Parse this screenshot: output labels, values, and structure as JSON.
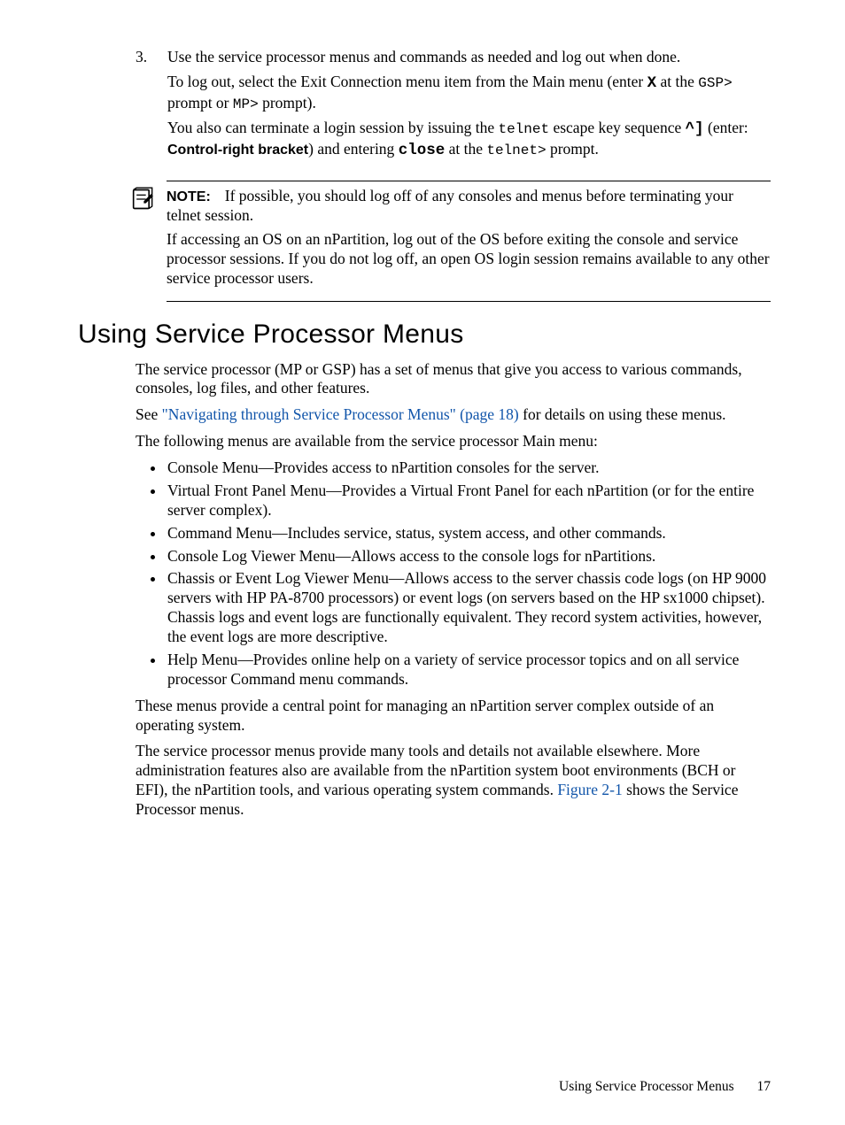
{
  "step": {
    "number": "3.",
    "para1_a": "Use the service processor menus and commands as needed and log out when done.",
    "para2_a": "To log out, select the Exit Connection menu item from the Main menu (enter ",
    "para2_b": "X",
    "para2_c": " at the ",
    "para2_d": "GSP>",
    "para2_e": " prompt or ",
    "para2_f": "MP>",
    "para2_g": " prompt).",
    "para3_a": "You also can terminate a login session by issuing the ",
    "para3_b": "telnet",
    "para3_c": " escape key sequence ",
    "para3_d": "^]",
    "para3_e": " (enter: ",
    "para3_f": "Control-right bracket",
    "para3_g": ") and entering ",
    "para3_h": "close",
    "para3_i": " at the ",
    "para3_j": "telnet>",
    "para3_k": " prompt."
  },
  "note": {
    "label": "NOTE:",
    "p1": "If possible, you should log off of any consoles and menus before terminating your telnet session.",
    "p2": "If accessing an OS on an nPartition, log out of the OS before exiting the console and service processor sessions. If you do not log off, an open OS login session remains available to any other service processor users."
  },
  "section": {
    "heading": "Using Service Processor Menus",
    "p1": "The service processor (MP or GSP) has a set of menus that give you access to various commands, consoles, log files, and other features.",
    "p2_a": "See ",
    "p2_link": "\"Navigating through Service Processor Menus\" (page 18)",
    "p2_b": " for details on using these menus.",
    "p3": "The following menus are available from the service processor Main menu:",
    "bullets": {
      "b1": "Console Menu—Provides access to nPartition consoles for the server.",
      "b2": "Virtual Front Panel Menu—Provides a Virtual Front Panel for each nPartition (or for the entire server complex).",
      "b3": "Command Menu—Includes service, status, system access, and other commands.",
      "b4": "Console Log Viewer Menu—Allows access to the console logs for nPartitions.",
      "b5": "Chassis or Event Log Viewer Menu—Allows access to the server chassis code logs (on HP 9000 servers with HP PA-8700 processors) or event logs (on servers based on the HP sx1000 chipset). Chassis logs and event logs are functionally equivalent. They record system activities, however, the event logs are more descriptive.",
      "b6": "Help Menu—Provides online help on a variety of service processor topics and on all service processor Command menu commands."
    },
    "p4": "These menus provide a central point for managing an nPartition server complex outside of an operating system.",
    "p5_a": "The service processor menus provide many tools and details not available elsewhere. More administration features also are available from the nPartition system boot environments (BCH or EFI), the nPartition tools, and various operating system commands. ",
    "p5_link": "Figure 2-1",
    "p5_b": " shows the Service Processor menus."
  },
  "footer": {
    "title": "Using Service Processor Menus",
    "page": "17"
  }
}
